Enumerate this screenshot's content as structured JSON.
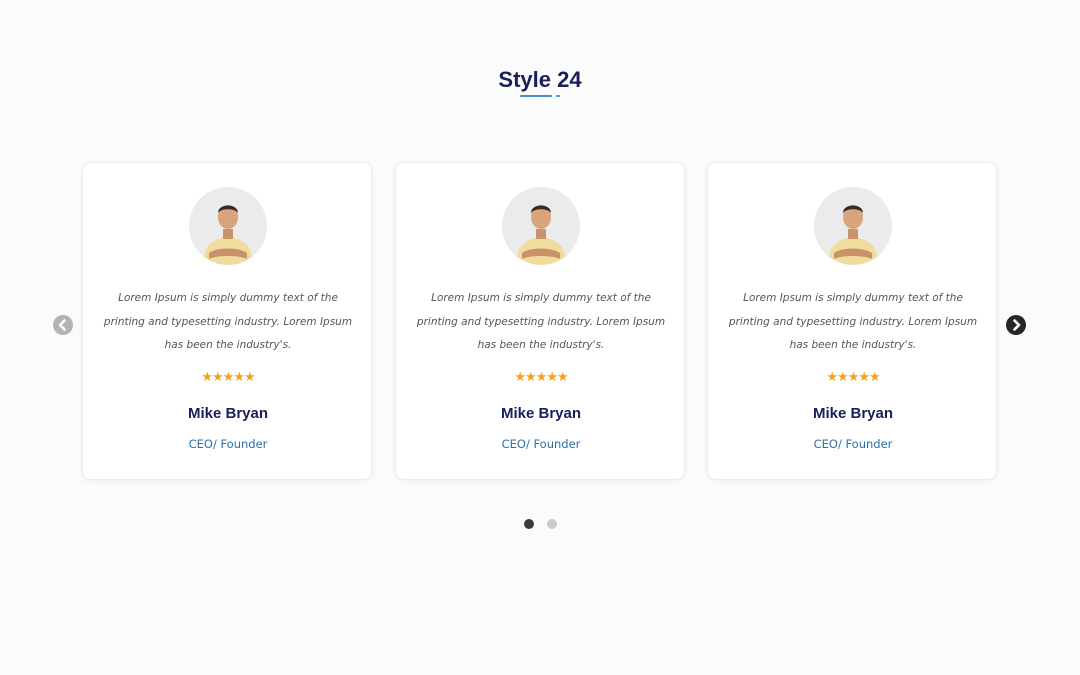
{
  "section": {
    "title": "Style 24"
  },
  "colors": {
    "title": "#1a1f5c",
    "accent": "#4a8fd0",
    "star": "#f2a31b",
    "role": "#2a6fa8",
    "quote": "#555555"
  },
  "testimonials": [
    {
      "quote": "Lorem Ipsum is simply dummy text of the printing and typesetting industry. Lorem Ipsum has been the industry's.",
      "rating": 5,
      "stars": "★★★★★",
      "name": "Mike Bryan",
      "role": "CEO/ Founder"
    },
    {
      "quote": "Lorem Ipsum is simply dummy text of the printing and typesetting industry. Lorem Ipsum has been the industry's.",
      "rating": 5,
      "stars": "★★★★★",
      "name": "Mike Bryan",
      "role": "CEO/ Founder"
    },
    {
      "quote": "Lorem Ipsum is simply dummy text of the printing and typesetting industry. Lorem Ipsum has been the industry's.",
      "rating": 5,
      "stars": "★★★★★",
      "name": "Mike Bryan",
      "role": "CEO/ Founder"
    }
  ],
  "navigation": {
    "prev_icon": "chevron-left-icon",
    "next_icon": "chevron-right-icon"
  },
  "pagination": {
    "total": 2,
    "active": 1
  }
}
